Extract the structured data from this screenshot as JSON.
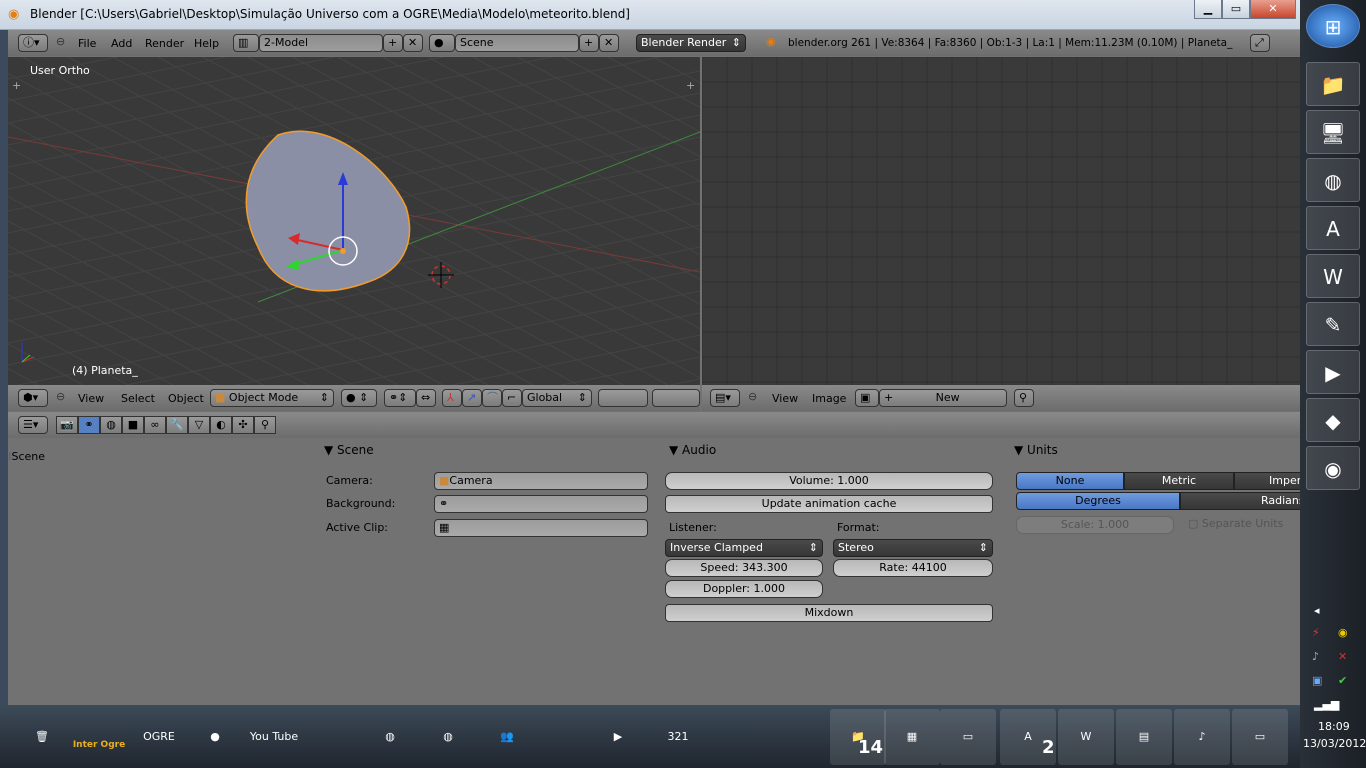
{
  "window": {
    "title": "Blender [C:\\Users\\Gabriel\\Desktop\\Simulação Universo com a OGRE\\Media\\Modelo\\meteorito.blend]",
    "minimize": "▁",
    "maximize": "▭",
    "close": "✕"
  },
  "top_header": {
    "menus": [
      "File",
      "Add",
      "Render",
      "Help"
    ],
    "screen_layout": "2-Model",
    "scene": "Scene",
    "render_engine": "Blender Render",
    "stats": "blender.org 261 | Ve:8364 | Fa:8360 | Ob:1-3 | La:1 | Mem:11.23M (0.10M) | Planeta_"
  },
  "viewport": {
    "view_label": "User Ortho",
    "object_label": "(4) Planeta_",
    "colors": {
      "bg": "#393939",
      "object": "#8a8fa6",
      "selection": "#f39c2a"
    }
  },
  "view3d_header": {
    "menus": [
      "View",
      "Select",
      "Object"
    ],
    "mode": "Object Mode",
    "orientation": "Global"
  },
  "image_header": {
    "menus": [
      "View",
      "Image"
    ],
    "new_label": "New"
  },
  "properties": {
    "tabs": [
      "render",
      "scene",
      "world",
      "object",
      "constraints",
      "modifiers",
      "data",
      "material",
      "particles",
      "physics"
    ],
    "active_tab": "scene",
    "tree_item": "Scene",
    "scene_panel": {
      "title": "Scene",
      "camera_label": "Camera:",
      "camera_value": "Camera",
      "background_label": "Background:",
      "background_value": "",
      "active_clip_label": "Active Clip:",
      "active_clip_value": ""
    },
    "audio_panel": {
      "title": "Audio",
      "volume": "Volume: 1.000",
      "update_cache": "Update animation cache",
      "listener_label": "Listener:",
      "listener_value": "Inverse Clamped",
      "format_label": "Format:",
      "format_value": "Stereo",
      "speed": "Speed: 343.300",
      "rate": "Rate: 44100",
      "doppler": "Doppler: 1.000",
      "mixdown": "Mixdown"
    },
    "units_panel": {
      "title": "Units",
      "systems": [
        "None",
        "Metric",
        "Imperial"
      ],
      "active_system": "None",
      "rotation": [
        "Degrees",
        "Radians"
      ],
      "active_rotation": "Degrees",
      "scale": "Scale: 1.000",
      "separate_units": "Separate Units",
      "separate_units_checked": false
    }
  },
  "taskbar": {
    "items": [
      "Recycle Bin",
      "Inter Ogre",
      "OGRE",
      "Pidgin",
      "YouTube",
      "Firefox",
      "Chrome",
      "Messenger",
      "Media Player",
      "321 Media",
      "Folder",
      "Monitor",
      "Chrome Window",
      "Adobe Reader",
      "Word",
      "Documents",
      "Music Player",
      "Window"
    ],
    "folder_count": "14",
    "reader_count": "2"
  },
  "tray": {
    "time": "18:09",
    "date": "13/03/2012"
  },
  "right_dock": [
    "Start",
    "Explorer",
    "Computer",
    "Chrome",
    "Adobe Reader",
    "Word",
    "Paint",
    "Media Player",
    "Notes",
    "Blender"
  ]
}
